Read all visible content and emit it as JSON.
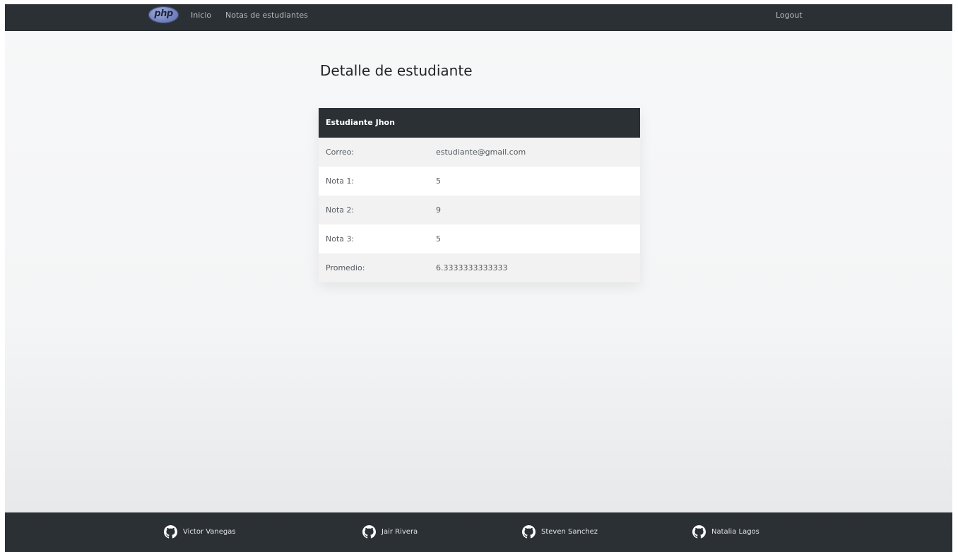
{
  "navbar": {
    "logo_text": "php",
    "links": [
      {
        "label": "Inicio"
      },
      {
        "label": "Notas de estudiantes"
      }
    ],
    "logout_label": "Logout"
  },
  "page": {
    "title": "Detalle de estudiante"
  },
  "student_card": {
    "header": "Estudiante Jhon",
    "rows": [
      {
        "label": "Correo:",
        "value": "estudiante@gmail.com"
      },
      {
        "label": "Nota 1:",
        "value": "5"
      },
      {
        "label": "Nota 2:",
        "value": "9"
      },
      {
        "label": "Nota 3:",
        "value": "5"
      },
      {
        "label": "Promedio:",
        "value": "6.3333333333333"
      }
    ]
  },
  "footer": {
    "authors": [
      {
        "name": "Victor Vanegas",
        "icon": "github-icon"
      },
      {
        "name": "Jair Rivera",
        "icon": "github-icon"
      },
      {
        "name": "Steven Sanchez",
        "icon": "github-icon"
      },
      {
        "name": "Natalia Lagos",
        "icon": "github-icon"
      }
    ]
  },
  "colors": {
    "navbar_bg": "#2b3035",
    "card_header_bg": "#2b3035",
    "footer_bg": "#2b3035",
    "striped_row": "#f2f2f2"
  }
}
